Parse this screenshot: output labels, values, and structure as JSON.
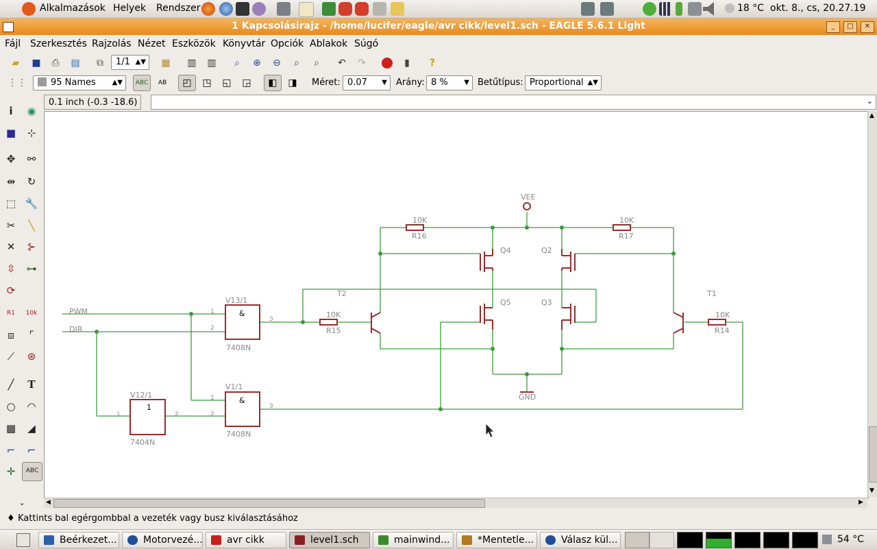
{
  "top_panel": {
    "menus": [
      "Alkalmazások",
      "Helyek",
      "Rendszer"
    ],
    "weather": "18 °C",
    "clock": "okt.  8., cs, 20.27.19"
  },
  "window": {
    "title": "1 Kapcsolásirajz - /home/lucifer/eagle/avr cikk/level1.sch - EAGLE 5.6.1 Light"
  },
  "menubar": [
    "Fájl",
    "Szerkesztés",
    "Rajzolás",
    "Nézet",
    "Eszközök",
    "Könyvtár",
    "Opciók",
    "Ablakok",
    "Súgó"
  ],
  "toolbar": {
    "sheet": "1/1",
    "layer": "95 Names",
    "meret_label": "Méret:",
    "meret_value": "0.07",
    "arany_label": "Arány:",
    "arany_value": "8 %",
    "font_label": "Betűtípus:",
    "font_value": "Proportional",
    "help": "?"
  },
  "coord": "0.1 inch (-0.3 -18.6)",
  "status": "Kattints bal egérgombbal a vezeték vagy busz kiválasztásához",
  "schematic": {
    "labels": {
      "vee": "VEE",
      "gnd": "GND",
      "pwm": "PWM",
      "dir": "DIR",
      "v13": "V13/1",
      "v1": "V1/1",
      "v12": "V12/1",
      "p7408a": "7408N",
      "p7408b": "7408N",
      "p7404": "7404N",
      "and_a": "&",
      "and_b": "&",
      "not": "1",
      "r16": "R16",
      "r17": "R17",
      "r15": "R15",
      "r14": "R14",
      "r16v": "10K",
      "r17v": "10K",
      "r15v": "10K",
      "r14v": "10K",
      "q4": "Q4",
      "q2": "Q2",
      "q5": "Q5",
      "q3": "Q3",
      "t2": "T2",
      "t1": "T1",
      "pin1a": "1",
      "pin2a": "2",
      "pin3a": "3",
      "pin1b": "1",
      "pin2b": "2",
      "pin3b": "3",
      "pin1c": "1",
      "pin2c": "2"
    }
  },
  "taskbar": [
    {
      "label": "Beérkezet...",
      "color": "#2c5fa8"
    },
    {
      "label": "Motorvezé...",
      "color": "#1f4f9a"
    },
    {
      "label": "avr cikk",
      "color": "#c8201a"
    },
    {
      "label": "level1.sch",
      "color": "#8a2020"
    },
    {
      "label": "mainwind...",
      "color": "#3a8a2a"
    },
    {
      "label": "*Mentetle...",
      "color": "#b07a20"
    },
    {
      "label": "Válasz kül...",
      "color": "#1f4f9a"
    }
  ],
  "tray": {
    "temp": "54 °C"
  }
}
